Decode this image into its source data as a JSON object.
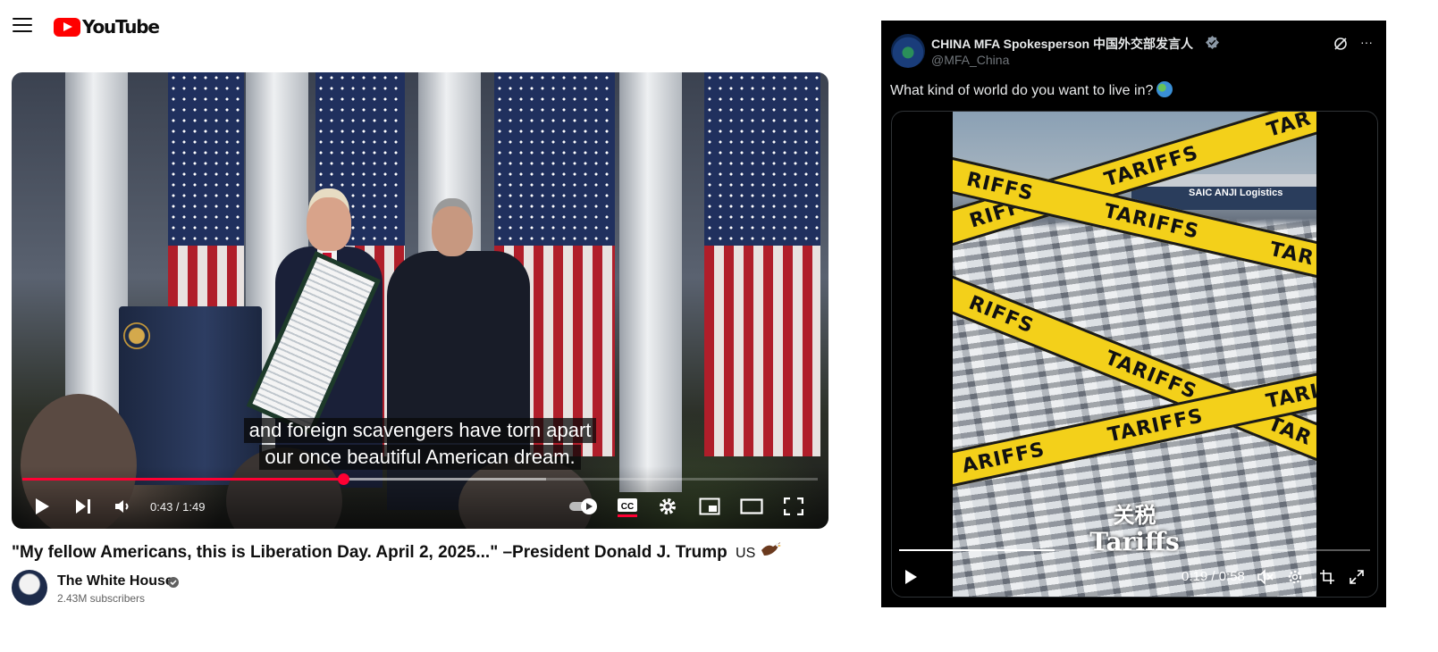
{
  "youtube": {
    "logo_text": "YouTube",
    "player": {
      "subtitles": [
        "and foreign scavengers have torn apart",
        "our once beautiful American dream."
      ],
      "time_display": "0:43 / 1:49",
      "progress": {
        "played_fraction": 0.403,
        "buffered_fraction": 0.658
      }
    },
    "video_title": "\"My fellow Americans, this is Liberation Day. April 2, 2025...\" –President Donald J. Trump",
    "title_suffix": "US",
    "channel": {
      "name": "The White House",
      "subscribers": "2.43M subscribers"
    }
  },
  "x_post": {
    "author_name": "CHINA MFA Spokesperson 中国外交部发言人",
    "author_handle": "@MFA_China",
    "more_label": "···",
    "text": "What kind of world do you want to live in?",
    "video": {
      "ship_text": "SAIC ANJI Logistics",
      "tape_text": "TARIFFS",
      "tape_variants": [
        "RIFFS",
        "ARIFFS",
        "TAR",
        "TARI"
      ],
      "caption_cn": "关税",
      "caption_en": "Tariffs",
      "time_display": "0:19 / 0:58",
      "played_fraction": 0.33
    }
  },
  "colors": {
    "youtube_red": "#ff0000",
    "progress_red": "#ff0033",
    "x_background": "#000000",
    "tape_yellow": "#f3d01a",
    "verified_blue": "#1d9bf0"
  },
  "icons": [
    "menu-icon",
    "play-icon",
    "next-icon",
    "volume-icon",
    "autoplay-toggle",
    "cc-icon",
    "settings-icon",
    "miniplayer-icon",
    "theater-icon",
    "fullscreen-icon",
    "verified-icon",
    "grok-icon",
    "more-icon",
    "globe-emoji",
    "muted-icon",
    "pip-icon",
    "expand-icon"
  ]
}
